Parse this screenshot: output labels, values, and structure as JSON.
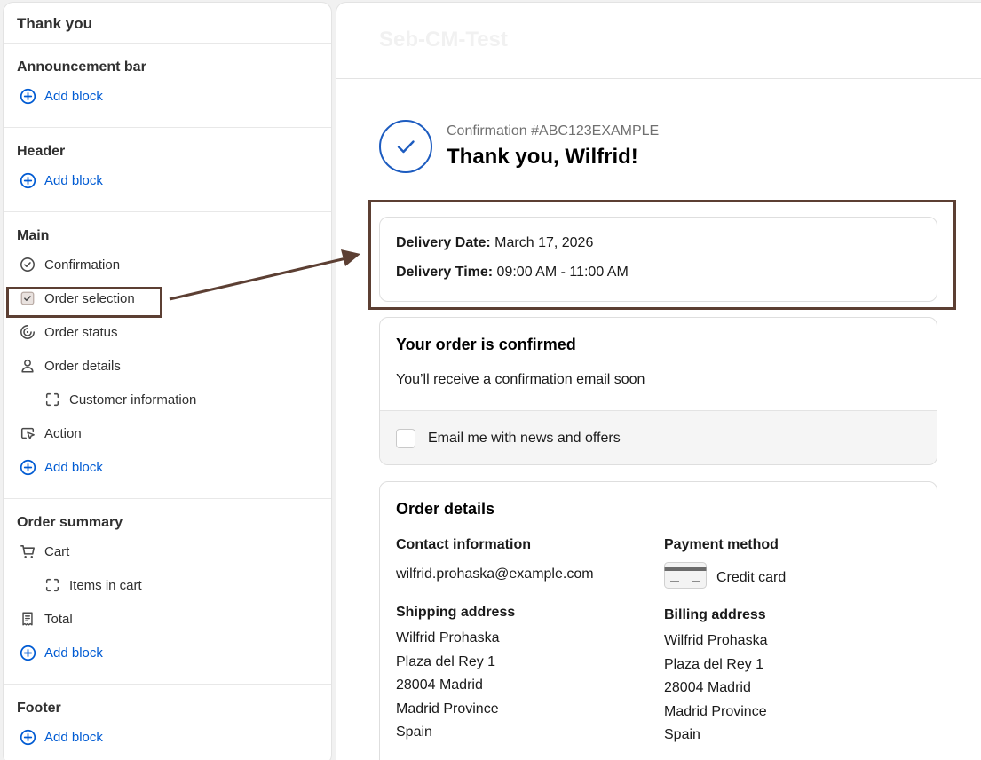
{
  "sidebar": {
    "title": "Thank you",
    "sections": {
      "announcement": {
        "heading": "Announcement bar",
        "add": "Add block"
      },
      "header": {
        "heading": "Header",
        "add": "Add block"
      },
      "main": {
        "heading": "Main",
        "items": [
          "Confirmation",
          "Order selection",
          "Order status",
          "Order details",
          "Customer information",
          "Action"
        ],
        "add": "Add block"
      },
      "order_summary": {
        "heading": "Order summary",
        "items": [
          "Cart",
          "Items in cart",
          "Total"
        ],
        "add": "Add block"
      },
      "footer": {
        "heading": "Footer",
        "add": "Add block"
      }
    }
  },
  "preview": {
    "shop_name": "Seb-CM-Test",
    "confirmation_number": "Confirmation #ABC123EXAMPLE",
    "thank_you": "Thank you, Wilfrid!",
    "delivery": {
      "date_label": "Delivery Date:",
      "date_value": "March 17, 2026",
      "time_label": "Delivery Time:",
      "time_value": "09:00 AM - 11:00 AM"
    },
    "confirmed": {
      "title": "Your order is confirmed",
      "message": "You’ll receive a confirmation email soon",
      "checkbox_label": "Email me with news and offers"
    },
    "order_details": {
      "title": "Order details",
      "contact_heading": "Contact information",
      "email": "wilfrid.prohaska@example.com",
      "payment_heading": "Payment method",
      "payment_value": "Credit card",
      "shipping_heading": "Shipping address",
      "shipping": [
        "Wilfrid Prohaska",
        "Plaza del Rey 1",
        "28004 Madrid",
        "Madrid Province",
        "Spain"
      ],
      "billing_heading": "Billing address",
      "billing": [
        "Wilfrid Prohaska",
        "Plaza del Rey 1",
        "28004 Madrid",
        "Madrid Province",
        "Spain"
      ]
    }
  },
  "colors": {
    "accent": "#005bd3",
    "annotation": "#5c3f33",
    "check": "#1d5cc0"
  }
}
